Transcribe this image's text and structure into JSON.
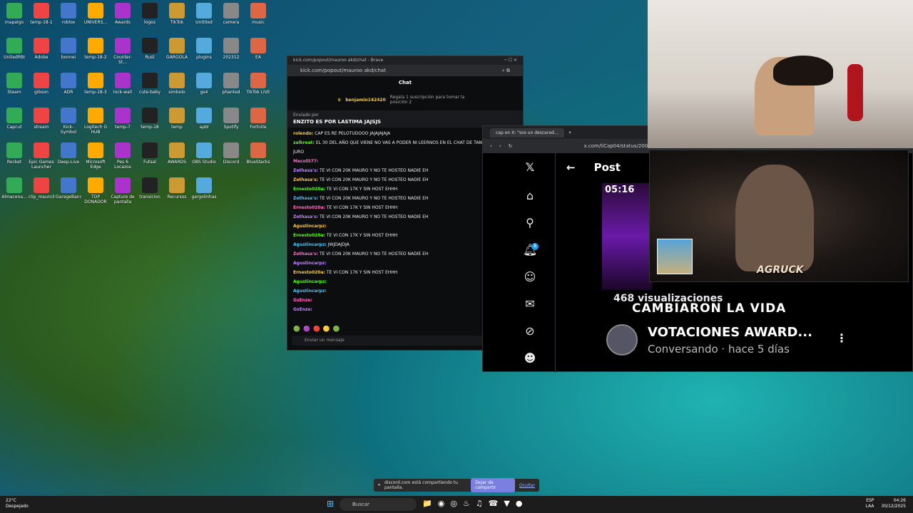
{
  "desktop": {
    "icon_labels": [
      "mapalgo",
      "temp-18-1",
      "roblox",
      "UNIVERS...",
      "Awards",
      "logos",
      "TikTok",
      "Untitled",
      "camera",
      "music",
      "UnitedRBI",
      "Adobe",
      "bonnei",
      "temp-18-2",
      "Counter-St...",
      "Rust",
      "GARGOLA",
      "plugins",
      "202312",
      "EA",
      "Steam",
      "gibson",
      "ADR",
      "temp-18-3",
      "lock-wall",
      "cute-baby",
      "simbolo",
      "gs4",
      "phanted",
      "TikTok LIVE",
      "Capcut",
      "stream",
      "Kick-Symbol",
      "Logitech G HUB",
      "temp-7",
      "temp-18",
      "temp",
      "apbl",
      "Spotify",
      "Fortnite",
      "Rocket",
      "Epic Games Launcher",
      "Deep-Live",
      "Microsoft Edge",
      "Pes 6 Locazos",
      "Futsal",
      "AWARDS",
      "OBS Studio",
      "Discord",
      "BlueStacks",
      "Almacena...",
      "clip_mauro3",
      "GarageBand",
      "TOP DONADOR",
      "Capture de pantalla",
      "transicion",
      "Recursos",
      "gargolinhas"
    ]
  },
  "kick": {
    "window_title": "kick.com/popout/mauroo akd/chat - Brave",
    "url": "kick.com/popout/mauroo akd/chat",
    "header": "Chat",
    "pinned_user": "benjamin142420",
    "pinned_text": "Regala 1 suscripción para tomar la posición 2",
    "sent_by": "Enviado por",
    "sent_message": "ENZITO ES POR LASTIMA JAJSJS",
    "messages": [
      {
        "user": "rolendo:",
        "text": "CAP ES RE PELOTUDOOO JAJAJAJAJA"
      },
      {
        "user": "zalkreat:",
        "text": "EL 30 DEL AÑO QUE VIENE NO VAS A PODER NI LEERNOS EN EL CHAT DE TANTOS CHATTERS"
      },
      {
        "user": "",
        "text": "JURO"
      },
      {
        "user": "Mecolit77:",
        "text": ""
      },
      {
        "user": "Zethasa's:",
        "text": "TE VI CON 20K MAURO Y NO TE HOSTEO NADIE EH"
      },
      {
        "user": "Zethasa's:",
        "text": "TE VI CON 20K MAURO Y NO TE HOSTEO NADIE EH"
      },
      {
        "user": "Ernesto020a:",
        "text": "TE VI CON 17K Y SIN HOST EHHH"
      },
      {
        "user": "Zethasa's:",
        "text": "TE VI CON 20K MAURO Y NO TE HOSTEO NADIE EH"
      },
      {
        "user": "Ernesto020a:",
        "text": "TE VI CON 17K Y SIN HOST EHHH"
      },
      {
        "user": "Zethasa's:",
        "text": "TE VI CON 20K MAURO Y NO TE HOSTEO NADIE EH"
      },
      {
        "user": "Agustincarpz:",
        "text": ""
      },
      {
        "user": "Ernesto020a:",
        "text": "TE VI CON 17K Y SIN HOST EHHH"
      },
      {
        "user": "Agustincarpz:",
        "text": "JWJDAJDJA"
      },
      {
        "user": "Zethasa's:",
        "text": "TE VI CON 20K MAURO Y NO TE HOSTEO NADIE EH"
      },
      {
        "user": "Agustincarpz:",
        "text": ""
      },
      {
        "user": "Ernesto020a:",
        "text": "TE VI CON 17K Y SIN HOST EHHH"
      },
      {
        "user": "Agustincarpz:",
        "text": ""
      },
      {
        "user": "Agustincarpz:",
        "text": ""
      },
      {
        "user": "GsEnze:",
        "text": ""
      },
      {
        "user": "GsEnze:",
        "text": ""
      }
    ],
    "input_placeholder": "Enviar un mensaje"
  },
  "x": {
    "tab_title": "cap en X: \"sos un descarad...",
    "url": "x.com/liCap04/status/200556",
    "header": "Post",
    "video_time": "05:16",
    "views": "468 visualizaciones",
    "overlay_text": "CAMBIARON LA VIDA",
    "card_title": "VOTACIONES AWARD...",
    "card_sub": "Conversando · hace 5 días",
    "notif_count": "8",
    "more_label": "⋮"
  },
  "webcam": {
    "overlay_name": "AGRUCK"
  },
  "sharebar": {
    "text": "discord.com está compartiendo tu pantalla.",
    "stop": "Dejar de compartir",
    "hide": "Ocultar"
  },
  "taskbar": {
    "temp": "22°C",
    "weather": "Despejado",
    "search": "Buscar",
    "lang": "ESP",
    "lang2": "LAA",
    "time": "04:26",
    "date": "30/12/2025"
  },
  "colors": {
    "kick_green": "#53fc18",
    "x_blue": "#1d9bf0",
    "share_btn": "#7a7fe0"
  }
}
